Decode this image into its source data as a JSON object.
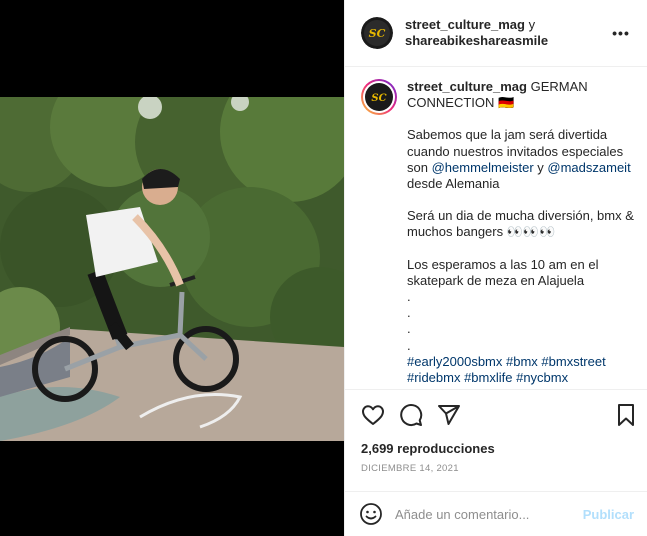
{
  "header": {
    "author": "street_culture_mag",
    "connector": "y",
    "collaborator": "shareabikeshareasmile",
    "more_label": "•••"
  },
  "caption": {
    "author": "street_culture_mag",
    "title": "GERMAN CONNECTION 🇩🇪",
    "p1_text": "Sabemos que la jam será divertida cuando nuestros invitados especiales son",
    "mention1": "@hemmelmeister",
    "p1_conj": "y",
    "mention2": "@madszameit",
    "p1_tail": "desde Alemania",
    "p2": "Será un dia de mucha diversión, bmx & muchos bangers 👀👀👀",
    "p3": "Los esperamos a las 10 am en el skatepark de meza en Alajuela",
    "dots": [
      ".",
      ".",
      ".",
      "."
    ],
    "hashtags_line1": "#early2000sbmx #bmx #bmxstreet",
    "hashtags_line2": "#ridebmx #bmxlife #nycbmx"
  },
  "stats": {
    "views": "2,699 reproducciones",
    "date": "DICIEMBRE 14, 2021"
  },
  "actions": {
    "like_icon": "heart-icon",
    "comment_icon": "comment-icon",
    "share_icon": "paper-plane-icon",
    "save_icon": "bookmark-icon"
  },
  "comment": {
    "placeholder": "Añade un comentario...",
    "publish_label": "Publicar"
  },
  "colors": {
    "link": "#00376b",
    "muted": "#8e8e8e",
    "publish_disabled": "#b2dffc",
    "avatar_logo": "#e7b800"
  }
}
